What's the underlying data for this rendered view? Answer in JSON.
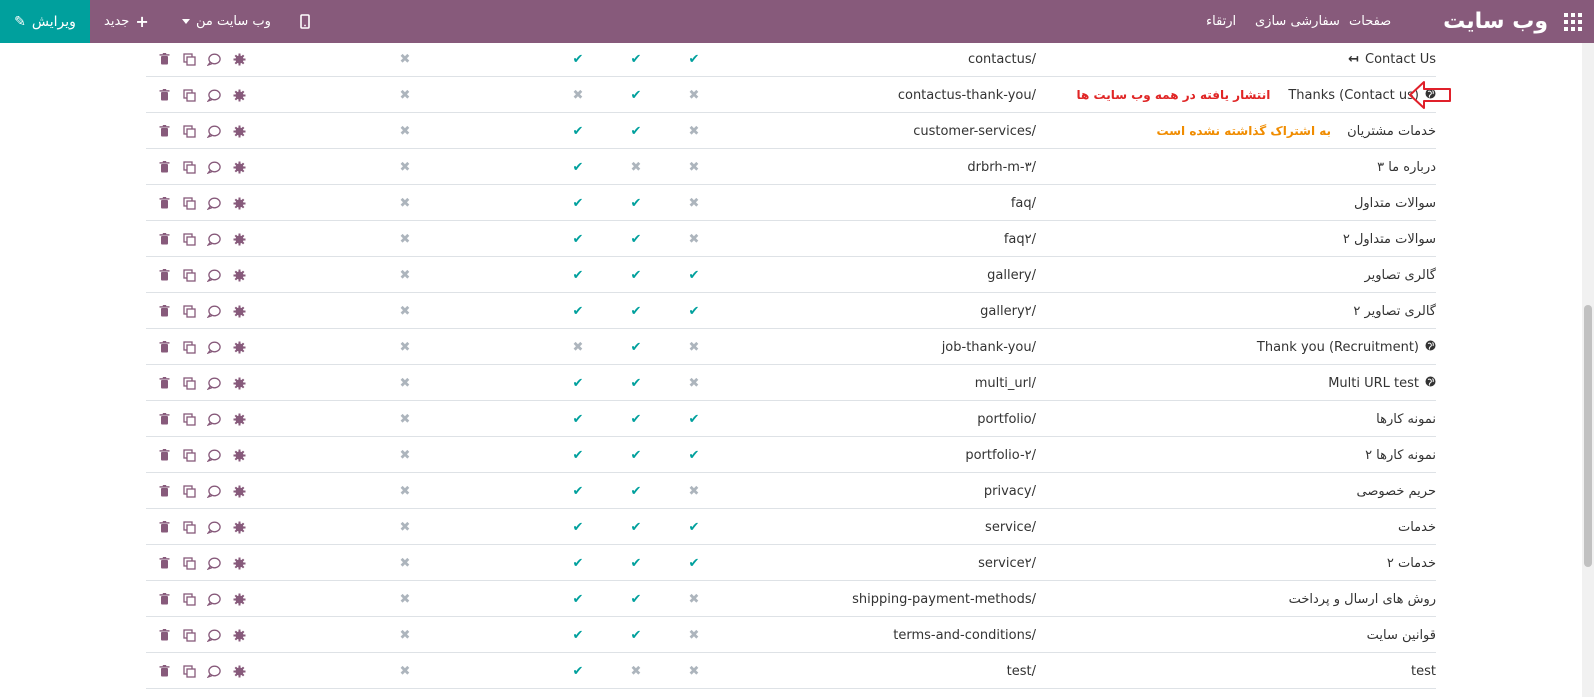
{
  "topbar": {
    "brand": "وب سایت",
    "nav": [
      "صفحات",
      "سفارشی سازی",
      "ارتقاء"
    ],
    "mobile_icon": "mobile-icon",
    "website_switch": "وب سایت من",
    "new_label": "جدید",
    "edit_label": "ویرایش",
    "colors": {
      "bar": "#875a7b",
      "edit": "#00a09d"
    }
  },
  "annotations": {
    "published_all": "انتشار یافته در همه وب سایت ها",
    "not_shared": "به اشتراک گذاشته نشده است"
  },
  "rows": [
    {
      "name": "Contact Us",
      "icon": "redirect-icon",
      "url": "contactus/",
      "m": [
        "x",
        "check",
        "check",
        "check"
      ]
    },
    {
      "name": "Thanks (Contact us)",
      "icon": "globe-icon",
      "url": "contactus-thank-you/",
      "m": [
        "x",
        "x",
        "check",
        "x"
      ]
    },
    {
      "name": "خدمات مشتریان",
      "url": "customer-services/",
      "m": [
        "x",
        "check",
        "check",
        "x"
      ]
    },
    {
      "name": "درباره ما ۳",
      "url": "drbrh-m-۳/",
      "m": [
        "x",
        "check",
        "x",
        "x"
      ]
    },
    {
      "name": "سوالات متداول",
      "url": "faq/",
      "m": [
        "x",
        "check",
        "check",
        "x"
      ]
    },
    {
      "name": "سوالات متداول ۲",
      "url": "faq۲/",
      "m": [
        "x",
        "check",
        "check",
        "x"
      ]
    },
    {
      "name": "گالری تصاویر",
      "url": "gallery/",
      "m": [
        "x",
        "check",
        "check",
        "check"
      ]
    },
    {
      "name": "گالری تصاویر ۲",
      "url": "gallery۲/",
      "m": [
        "x",
        "check",
        "check",
        "check"
      ]
    },
    {
      "name": "Thank you (Recruitment)",
      "icon": "globe-icon",
      "url": "job-thank-you/",
      "m": [
        "x",
        "x",
        "check",
        "x"
      ]
    },
    {
      "name": "Multi URL test",
      "icon": "globe-icon",
      "url": "multi_url/",
      "m": [
        "x",
        "check",
        "check",
        "x"
      ]
    },
    {
      "name": "نمونه کارها",
      "url": "portfolio/",
      "m": [
        "x",
        "check",
        "check",
        "check"
      ]
    },
    {
      "name": "نمونه کارها ۲",
      "url": "portfolio-۲/",
      "m": [
        "x",
        "check",
        "check",
        "check"
      ]
    },
    {
      "name": "حریم خصوصی",
      "url": "privacy/",
      "m": [
        "x",
        "check",
        "check",
        "x"
      ]
    },
    {
      "name": "خدمات",
      "url": "service/",
      "m": [
        "x",
        "check",
        "check",
        "check"
      ]
    },
    {
      "name": "خدمات ۲",
      "url": "service۲/",
      "m": [
        "x",
        "check",
        "check",
        "check"
      ]
    },
    {
      "name": "روش های ارسال و پرداخت",
      "url": "shipping-payment-methods/",
      "m": [
        "x",
        "check",
        "check",
        "x"
      ]
    },
    {
      "name": "قوانین سایت",
      "url": "terms-and-conditions/",
      "m": [
        "x",
        "check",
        "check",
        "x"
      ]
    },
    {
      "name": "test",
      "url": "test/",
      "m": [
        "x",
        "check",
        "x",
        "x"
      ]
    }
  ]
}
